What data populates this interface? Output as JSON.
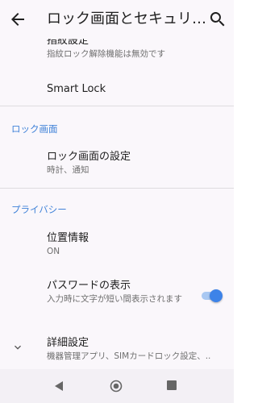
{
  "header": {
    "title": "ロック画面とセキュリ…"
  },
  "items": {
    "fingerprint": {
      "title": "指紋設定",
      "summary": "指紋ロック解除機能は無効です"
    },
    "smart_lock": {
      "title": "Smart Lock"
    },
    "lock_screen_settings": {
      "title": "ロック画面の設定",
      "summary": "時計、通知"
    },
    "location": {
      "title": "位置情報",
      "summary": "ON"
    },
    "show_passwords": {
      "title": "パスワードの表示",
      "summary": "入力時に文字が短い間表示されます",
      "enabled": true
    },
    "advanced": {
      "title": "詳細設定",
      "summary": "機器管理アプリ、SIMカードロック設定、.."
    }
  },
  "sections": {
    "lock_screen": "ロック画面",
    "privacy": "プライバシー"
  },
  "colors": {
    "accent": "#3f82d8",
    "toggle_thumb": "#3d83e8",
    "toggle_track": "#a9c8f2"
  },
  "icons": {
    "back": "arrow-left",
    "search": "magnifier",
    "expand": "chevron-down",
    "nav_back": "triangle-left",
    "nav_home": "circle",
    "nav_recent": "square"
  }
}
